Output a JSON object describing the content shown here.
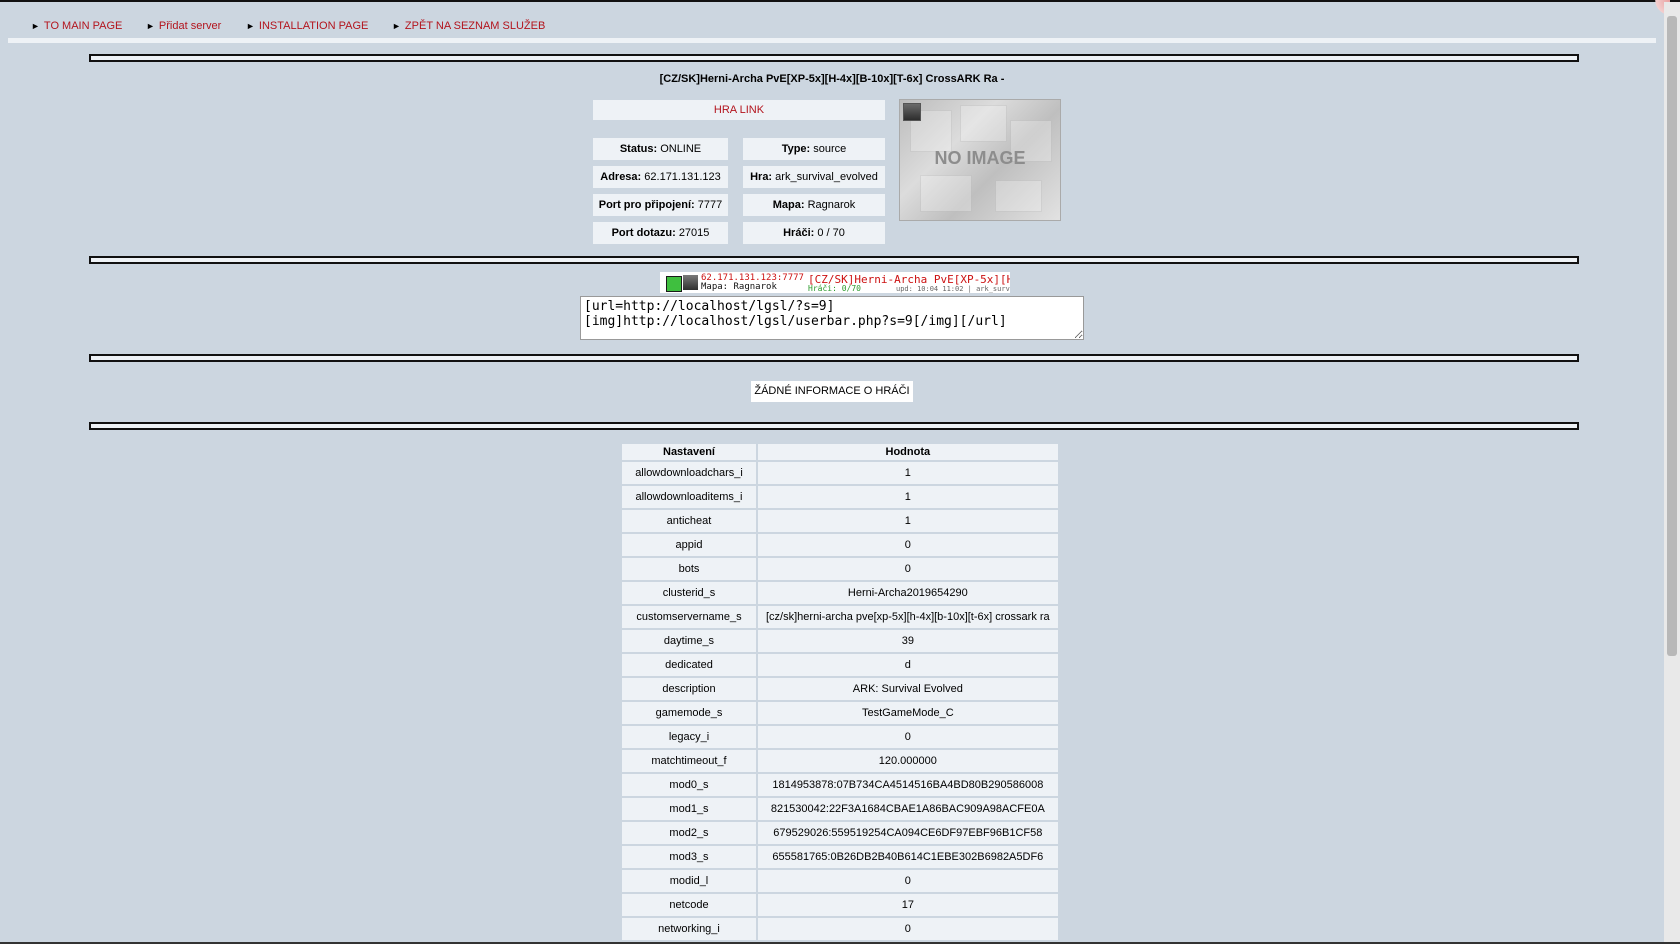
{
  "nav": [
    {
      "label": "TO MAIN PAGE"
    },
    {
      "label": "Přidat server"
    },
    {
      "label": "INSTALLATION PAGE"
    },
    {
      "label": "ZPĚT NA SEZNAM SLUŽEB"
    }
  ],
  "server": {
    "title": "[CZ/SK]Herni-Archa PvE[XP-5x][H-4x][B-10x][T-6x] CrossARK Ra -",
    "link_label": "HRA LINK",
    "image_label": "NO IMAGE",
    "info": {
      "status": {
        "label": "Status:",
        "value": "ONLINE"
      },
      "type": {
        "label": "Type:",
        "value": "source"
      },
      "address": {
        "label": "Adresa:",
        "value": "62.171.131.123"
      },
      "game": {
        "label": "Hra:",
        "value": "ark_survival_evolved"
      },
      "connect_port": {
        "label": "Port pro připojení:",
        "value": "7777"
      },
      "map": {
        "label": "Mapa:",
        "value": "Ragnarok"
      },
      "query_port": {
        "label": "Port dotazu:",
        "value": "27015"
      },
      "players": {
        "label": "Hráči:",
        "value": "0 / 70"
      }
    }
  },
  "userbar": {
    "address": "62.171.131.123:7777",
    "map": "Mapa: Ragnarok",
    "name": "[CZ/SK]Herni-Archa PvE[XP-5x][H-4x",
    "players": "Hráči: 0/70",
    "updated": "upd: 10:04 11:02 | ark_survival"
  },
  "bbcode": "[url=http://localhost/lgsl/?s=9]\n[img]http://localhost/lgsl/userbar.php?s=9[/img][/url]",
  "no_player_info": "ŽÁDNÉ INFORMACE O HRÁČI",
  "settings": {
    "headers": {
      "key": "Nastavení",
      "value": "Hodnota"
    },
    "rows": [
      {
        "k": "allowdownloadchars_i",
        "v": "1"
      },
      {
        "k": "allowdownloaditems_i",
        "v": "1"
      },
      {
        "k": "anticheat",
        "v": "1"
      },
      {
        "k": "appid",
        "v": "0"
      },
      {
        "k": "bots",
        "v": "0"
      },
      {
        "k": "clusterid_s",
        "v": "Herni-Archa2019654290"
      },
      {
        "k": "customservername_s",
        "v": "[cz/sk]herni-archa pve[xp-5x][h-4x][b-10x][t-6x] crossark ra"
      },
      {
        "k": "daytime_s",
        "v": "39"
      },
      {
        "k": "dedicated",
        "v": "d"
      },
      {
        "k": "description",
        "v": "ARK: Survival Evolved"
      },
      {
        "k": "gamemode_s",
        "v": "TestGameMode_C"
      },
      {
        "k": "legacy_i",
        "v": "0"
      },
      {
        "k": "matchtimeout_f",
        "v": "120.000000"
      },
      {
        "k": "mod0_s",
        "v": "1814953878:07B734CA4514516BA4BD80B290586008"
      },
      {
        "k": "mod1_s",
        "v": "821530042:22F3A1684CBAE1A86BAC909A98ACFE0A"
      },
      {
        "k": "mod2_s",
        "v": "679529026:559519254CA094CE6DF97EBF96B1CF58"
      },
      {
        "k": "mod3_s",
        "v": "655581765:0B26DB2B40B614C1EBE302B6982A5DF6"
      },
      {
        "k": "modid_l",
        "v": "0"
      },
      {
        "k": "netcode",
        "v": "17"
      },
      {
        "k": "networking_i",
        "v": "0"
      }
    ]
  }
}
